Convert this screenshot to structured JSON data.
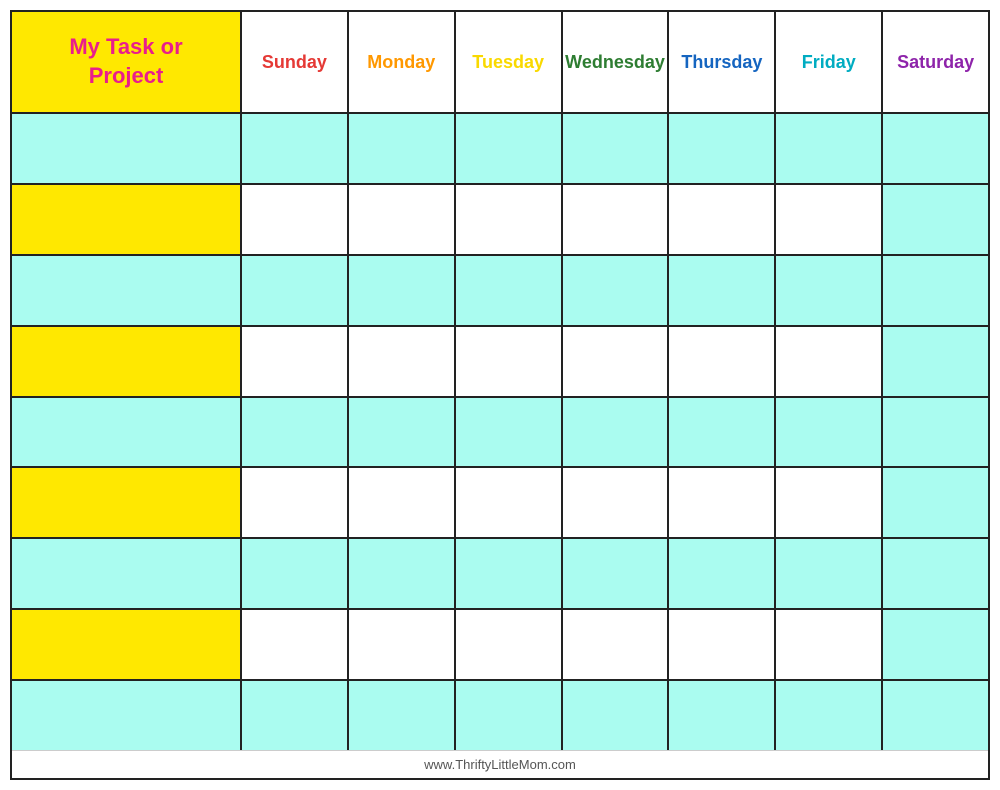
{
  "header": {
    "task_label_line1": "My Task or",
    "task_label_line2": "Project",
    "days": [
      {
        "label": "Sunday",
        "color_class": "sun"
      },
      {
        "label": "Monday",
        "color_class": "mon"
      },
      {
        "label": "Tuesday",
        "color_class": "tue"
      },
      {
        "label": "Wednesday",
        "color_class": "wed"
      },
      {
        "label": "Thursday",
        "color_class": "thu"
      },
      {
        "label": "Friday",
        "color_class": "fri"
      },
      {
        "label": "Saturday",
        "color_class": "sat"
      }
    ]
  },
  "rows": [
    {
      "task_bg": "cyan",
      "cells": [
        "cyan",
        "cyan",
        "cyan",
        "cyan",
        "cyan",
        "cyan",
        "cyan"
      ]
    },
    {
      "task_bg": "yellow",
      "cells": [
        "white",
        "white",
        "white",
        "white",
        "white",
        "white",
        "cyan"
      ]
    },
    {
      "task_bg": "cyan",
      "cells": [
        "cyan",
        "cyan",
        "cyan",
        "cyan",
        "cyan",
        "cyan",
        "cyan"
      ]
    },
    {
      "task_bg": "yellow",
      "cells": [
        "white",
        "white",
        "white",
        "white",
        "white",
        "white",
        "cyan"
      ]
    },
    {
      "task_bg": "cyan",
      "cells": [
        "cyan",
        "cyan",
        "cyan",
        "cyan",
        "cyan",
        "cyan",
        "cyan"
      ]
    },
    {
      "task_bg": "yellow",
      "cells": [
        "white",
        "white",
        "white",
        "white",
        "white",
        "white",
        "cyan"
      ]
    },
    {
      "task_bg": "cyan",
      "cells": [
        "cyan",
        "cyan",
        "cyan",
        "cyan",
        "cyan",
        "cyan",
        "cyan"
      ]
    },
    {
      "task_bg": "yellow",
      "cells": [
        "white",
        "white",
        "white",
        "white",
        "white",
        "white",
        "cyan"
      ]
    },
    {
      "task_bg": "cyan",
      "cells": [
        "cyan",
        "cyan",
        "cyan",
        "cyan",
        "cyan",
        "cyan",
        "cyan"
      ]
    }
  ],
  "footer": {
    "url": "www.ThriftyLittleMom.com"
  }
}
